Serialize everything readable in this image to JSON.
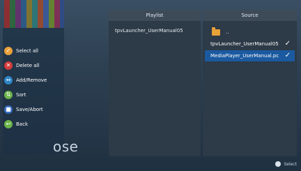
{
  "sidebar": {
    "items": [
      {
        "label": "Select all",
        "icon": "select-all-icon",
        "color": "#e9a13a",
        "glyph": "✓"
      },
      {
        "label": "Delete all",
        "icon": "delete-icon",
        "color": "#d23b3b",
        "glyph": "🗑"
      },
      {
        "label": "Add/Remove",
        "icon": "add-remove-icon",
        "color": "#2e86c7",
        "glyph": "↔"
      },
      {
        "label": "Sort",
        "icon": "sort-icon",
        "color": "#6bb44a",
        "glyph": "⇅"
      },
      {
        "label": "Save/Abort",
        "icon": "save-icon",
        "color": "#3a6fc2",
        "glyph": "💾"
      },
      {
        "label": "Back",
        "icon": "back-icon",
        "color": "#6bb44a",
        "glyph": "↩"
      }
    ]
  },
  "background": {
    "title_fragment": "ose"
  },
  "playlist": {
    "header": "Playlist",
    "items": [
      "tpvLauncher_UserManual05"
    ]
  },
  "source": {
    "header": "Source",
    "items": [
      {
        "label": "..",
        "type": "folder"
      },
      {
        "label": "tpvLauncher_UserManual05",
        "checked": true
      },
      {
        "label": "MediaPlayer_UserManual.pc",
        "checked": true,
        "selected": true
      }
    ]
  },
  "footer": {
    "label": "Select"
  }
}
